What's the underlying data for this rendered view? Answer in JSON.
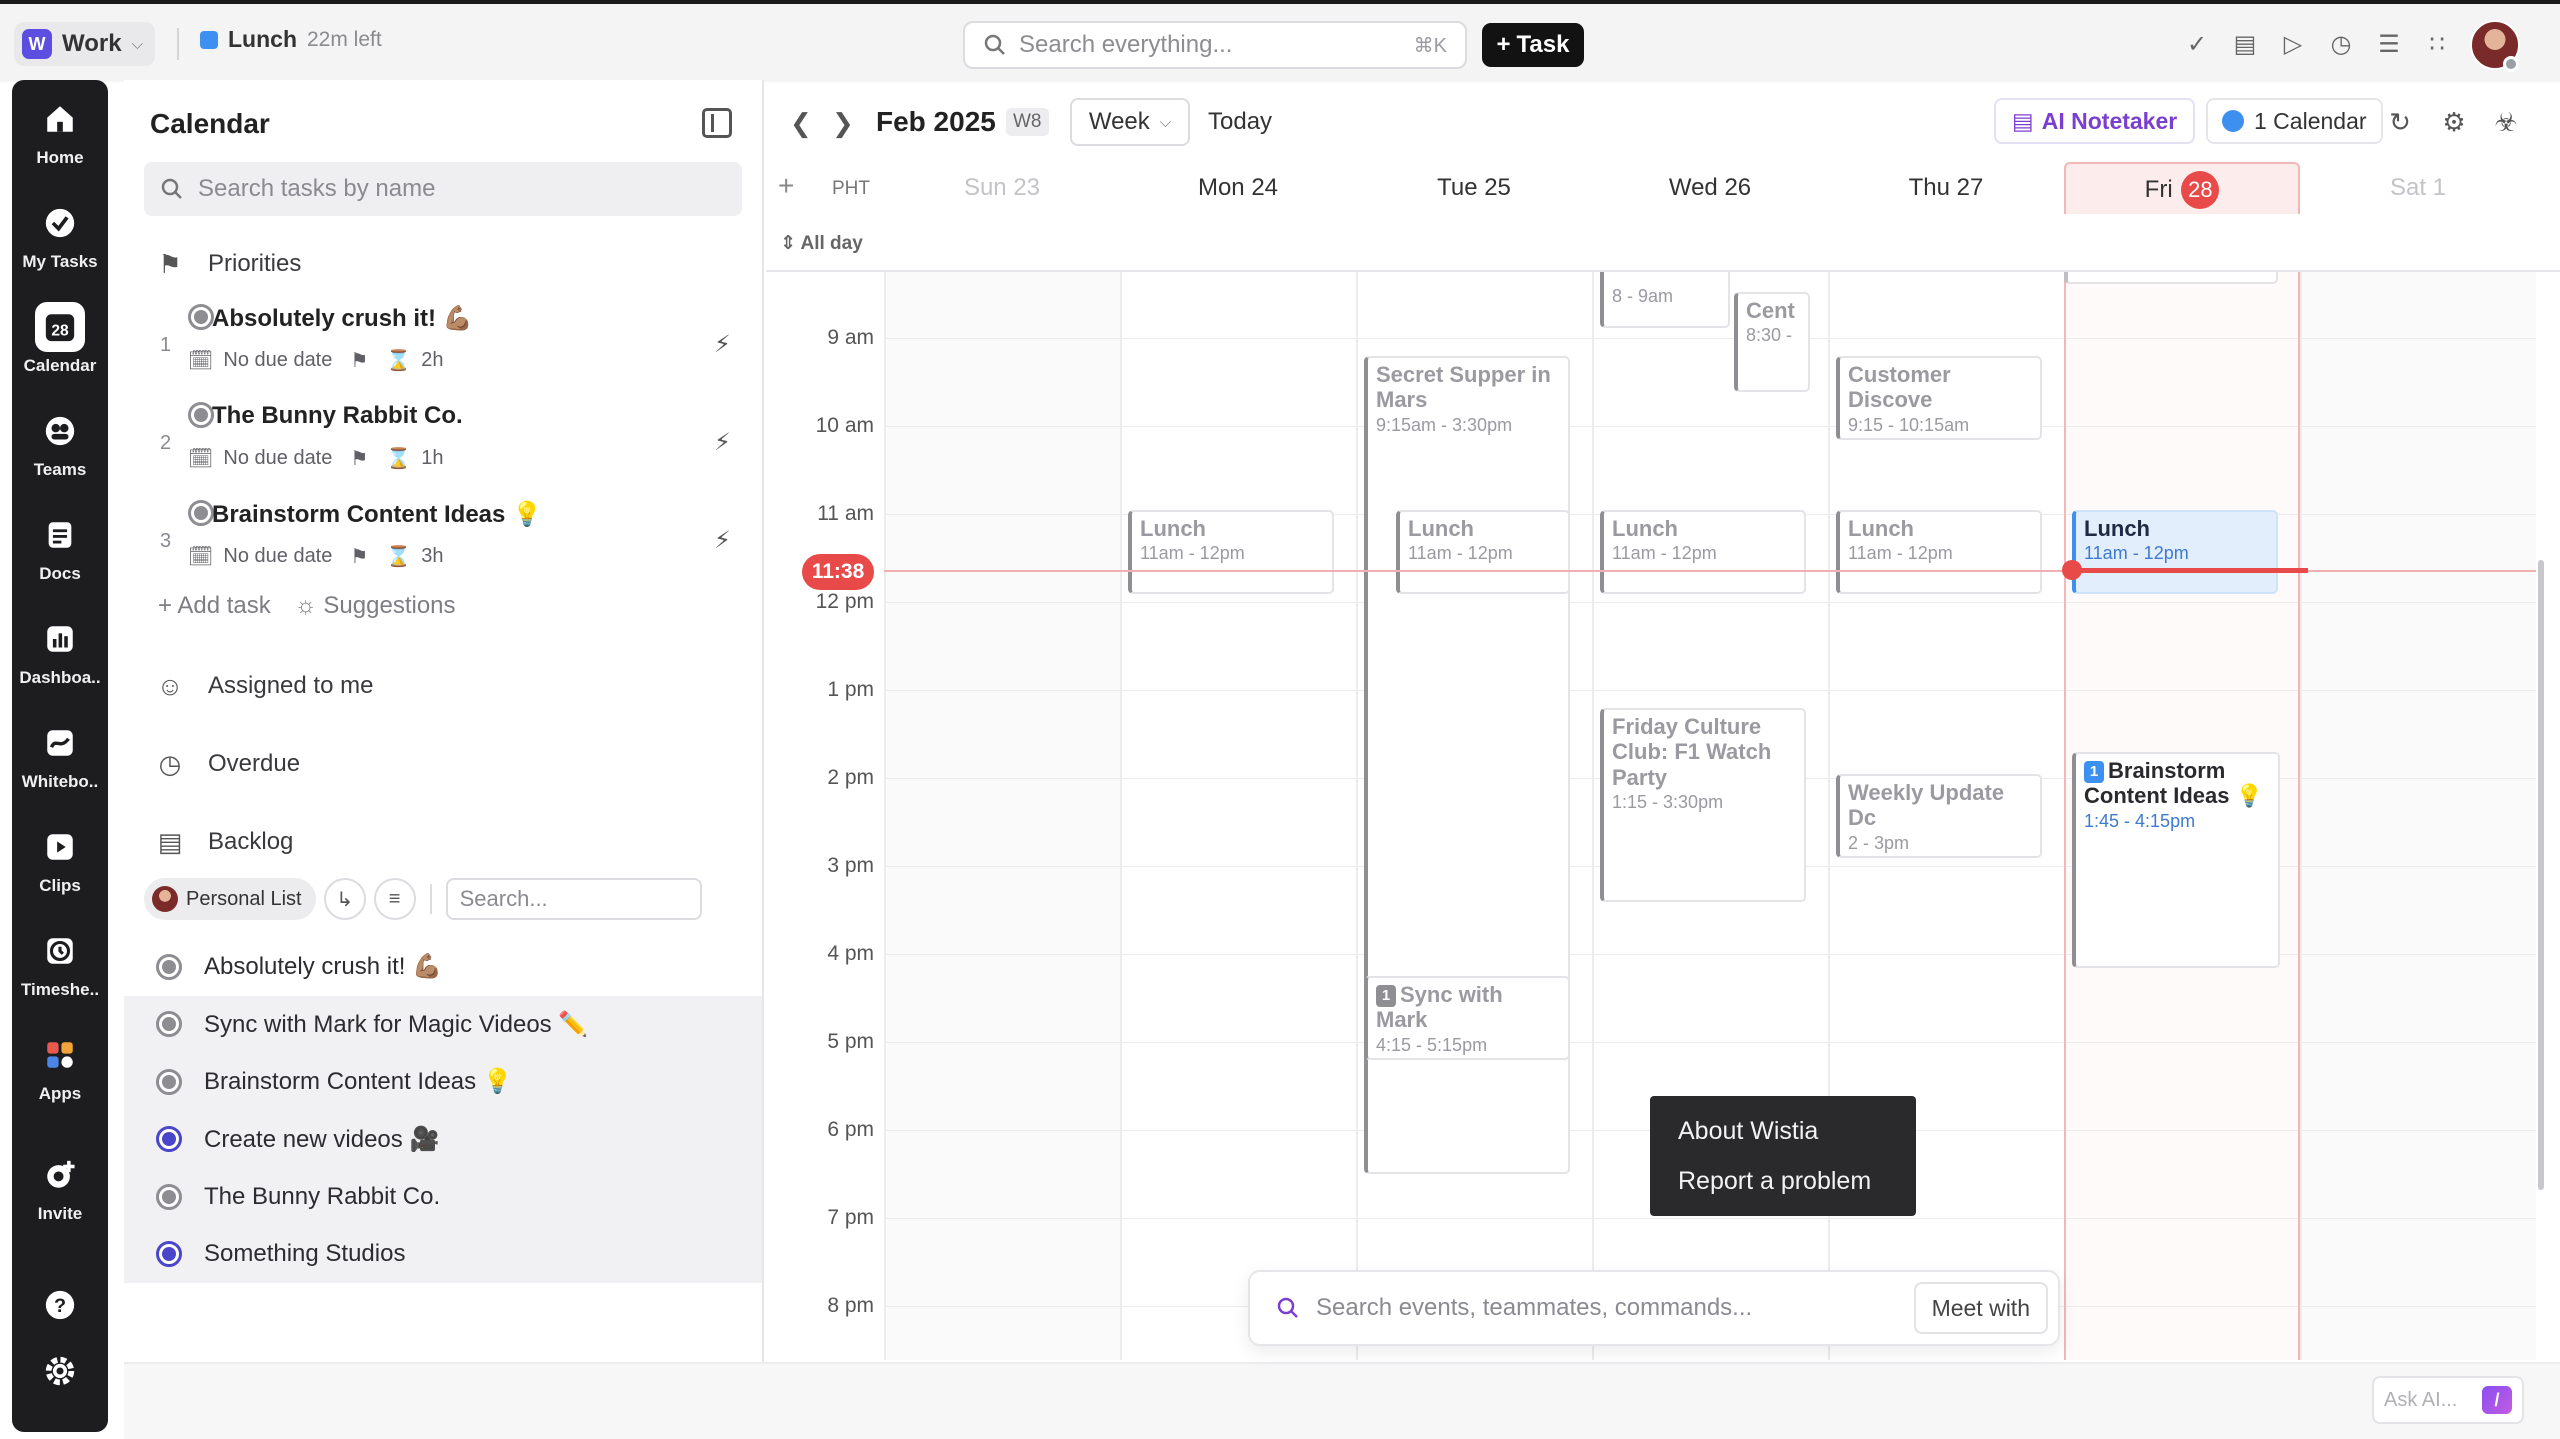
{
  "topbar": {
    "workspace_initial": "W",
    "workspace_name": "Work",
    "timer_name": "Lunch",
    "timer_left": "22m left",
    "search_placeholder": "Search everything...",
    "search_shortcut": "⌘K",
    "task_button": "Task"
  },
  "leftnav": {
    "items": [
      {
        "label": "Home",
        "icon": "home-icon"
      },
      {
        "label": "My Tasks",
        "icon": "check-circle-icon"
      },
      {
        "label": "Calendar",
        "icon": "calendar-icon",
        "day": "28"
      },
      {
        "label": "Teams",
        "icon": "teams-icon"
      },
      {
        "label": "Docs",
        "icon": "docs-icon"
      },
      {
        "label": "Dashboa..",
        "icon": "dashboard-icon"
      },
      {
        "label": "Whitebo..",
        "icon": "whiteboard-icon"
      },
      {
        "label": "Clips",
        "icon": "clips-icon"
      },
      {
        "label": "Timeshe..",
        "icon": "timesheet-icon"
      },
      {
        "label": "Apps",
        "icon": "apps-icon"
      },
      {
        "label": "Invite",
        "icon": "invite-icon"
      }
    ]
  },
  "sidebar": {
    "title": "Calendar",
    "search_placeholder": "Search tasks by name",
    "priorities_label": "Priorities",
    "priorities": [
      {
        "num": "1",
        "name": "Absolutely crush it! 💪🏽",
        "due": "No due date",
        "estimate": "2h"
      },
      {
        "num": "2",
        "name": "The Bunny Rabbit Co.",
        "due": "No due date",
        "estimate": "1h"
      },
      {
        "num": "3",
        "name": "Brainstorm Content Ideas 💡",
        "due": "No due date",
        "estimate": "3h"
      }
    ],
    "add_task": "Add task",
    "suggestions": "Suggestions",
    "assigned_label": "Assigned to me",
    "overdue_label": "Overdue",
    "backlog_label": "Backlog",
    "backlog_chip": "Personal List",
    "backlog_search_placeholder": "Search...",
    "backlog": [
      {
        "name": "Absolutely crush it! 💪🏽",
        "status": "gray"
      },
      {
        "name": "Sync with Mark for Magic Videos ✏️",
        "status": "gray"
      },
      {
        "name": "Brainstorm Content Ideas 💡",
        "status": "gray"
      },
      {
        "name": "Create new videos 🎥",
        "status": "blue"
      },
      {
        "name": "The Bunny Rabbit Co.",
        "status": "gray"
      },
      {
        "name": "Something Studios",
        "status": "blue"
      }
    ]
  },
  "toolbar": {
    "month": "Feb 2025",
    "week": "W8",
    "view": "Week",
    "today": "Today",
    "ai_notetaker": "AI Notetaker",
    "calendars": "1 Calendar"
  },
  "calendar": {
    "timezone": "PHT",
    "all_day": "All day",
    "days": [
      {
        "label": "Sun 23",
        "muted": true
      },
      {
        "label": "Mon 24",
        "muted": false
      },
      {
        "label": "Tue 25",
        "muted": false
      },
      {
        "label": "Wed 26",
        "muted": false
      },
      {
        "label": "Thu 27",
        "muted": false
      },
      {
        "label": "Fri",
        "num": "28",
        "today": true
      },
      {
        "label": "Sat  1",
        "muted": true
      }
    ],
    "hours": [
      "9 am",
      "10 am",
      "11 am",
      "12 pm",
      "1 pm",
      "2 pm",
      "3 pm",
      "4 pm",
      "5 pm",
      "6 pm",
      "7 pm",
      "8 pm"
    ],
    "now": "11:38",
    "events": [
      {
        "title": "",
        "time": "8 - 9am"
      },
      {
        "title": "Cent",
        "time": "8:30 -"
      },
      {
        "title": "Secret Supper in Mars",
        "time": "9:15am - 3:30pm"
      },
      {
        "title": "Customer Discove",
        "time": "9:15 - 10:15am"
      },
      {
        "title": "Lunch",
        "time": "11am - 12pm"
      },
      {
        "title": "Lunch",
        "time": "11am - 12pm"
      },
      {
        "title": "Lunch",
        "time": "11am - 12pm"
      },
      {
        "title": "Lunch",
        "time": "11am - 12pm"
      },
      {
        "title": "Lunch",
        "time": "11am - 12pm"
      },
      {
        "title": "Friday Culture Club: F1 Watch Party",
        "time": "1:15 - 3:30pm"
      },
      {
        "title": "Weekly Update Dc",
        "time": "2 - 3pm"
      },
      {
        "title": "Brainstorm Content Ideas 💡",
        "time": "1:45 - 4:15pm",
        "badge": "1"
      },
      {
        "title": "Sync with Mark",
        "time": "4:15 - 5:15pm",
        "badge": "1"
      }
    ]
  },
  "context_menu": {
    "items": [
      "About Wistia",
      "Report a problem"
    ]
  },
  "command_bar": {
    "placeholder": "Search events, teammates, commands...",
    "meet_with": "Meet with"
  },
  "ask_ai": {
    "placeholder": "Ask AI...",
    "badge": "/"
  },
  "colors": {
    "accent": "#3d8ff0",
    "today_red": "#e84a4a",
    "nav_bg": "#1d1d20",
    "ai_purple": "#7b3fd0"
  }
}
